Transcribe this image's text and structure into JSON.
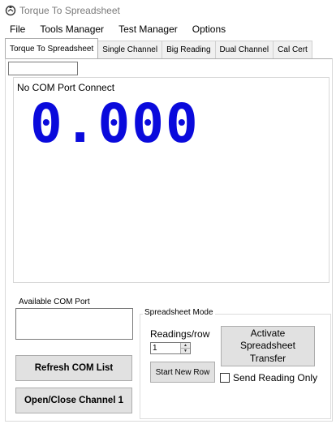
{
  "window": {
    "title": "Torque To Spreadsheet"
  },
  "menu": [
    {
      "label": "File"
    },
    {
      "label": "Tools Manager"
    },
    {
      "label": "Test Manager"
    },
    {
      "label": "Options"
    }
  ],
  "tabs": [
    {
      "label": "Torque To Spreadsheet",
      "active": true
    },
    {
      "label": "Single Channel",
      "active": false
    },
    {
      "label": "Big Reading",
      "active": false
    },
    {
      "label": "Dual Channel",
      "active": false
    },
    {
      "label": "Cal Cert",
      "active": false
    }
  ],
  "display": {
    "status": "No COM Port Connect",
    "reading": "0.000",
    "reading_color": "#0a0adc"
  },
  "com": {
    "label": "Available COM Port",
    "refresh_button": "Refresh COM List",
    "open_close_button": "Open/Close Channel 1"
  },
  "spreadsheet": {
    "group_label": "Spreadsheet Mode",
    "readings_label": "Readings/row",
    "readings_value": "1",
    "start_new_row_button": "Start New Row",
    "activate_button": "Activate Spreadsheet Transfer",
    "send_reading_only_label": "Send Reading Only",
    "send_reading_only_checked": false
  }
}
